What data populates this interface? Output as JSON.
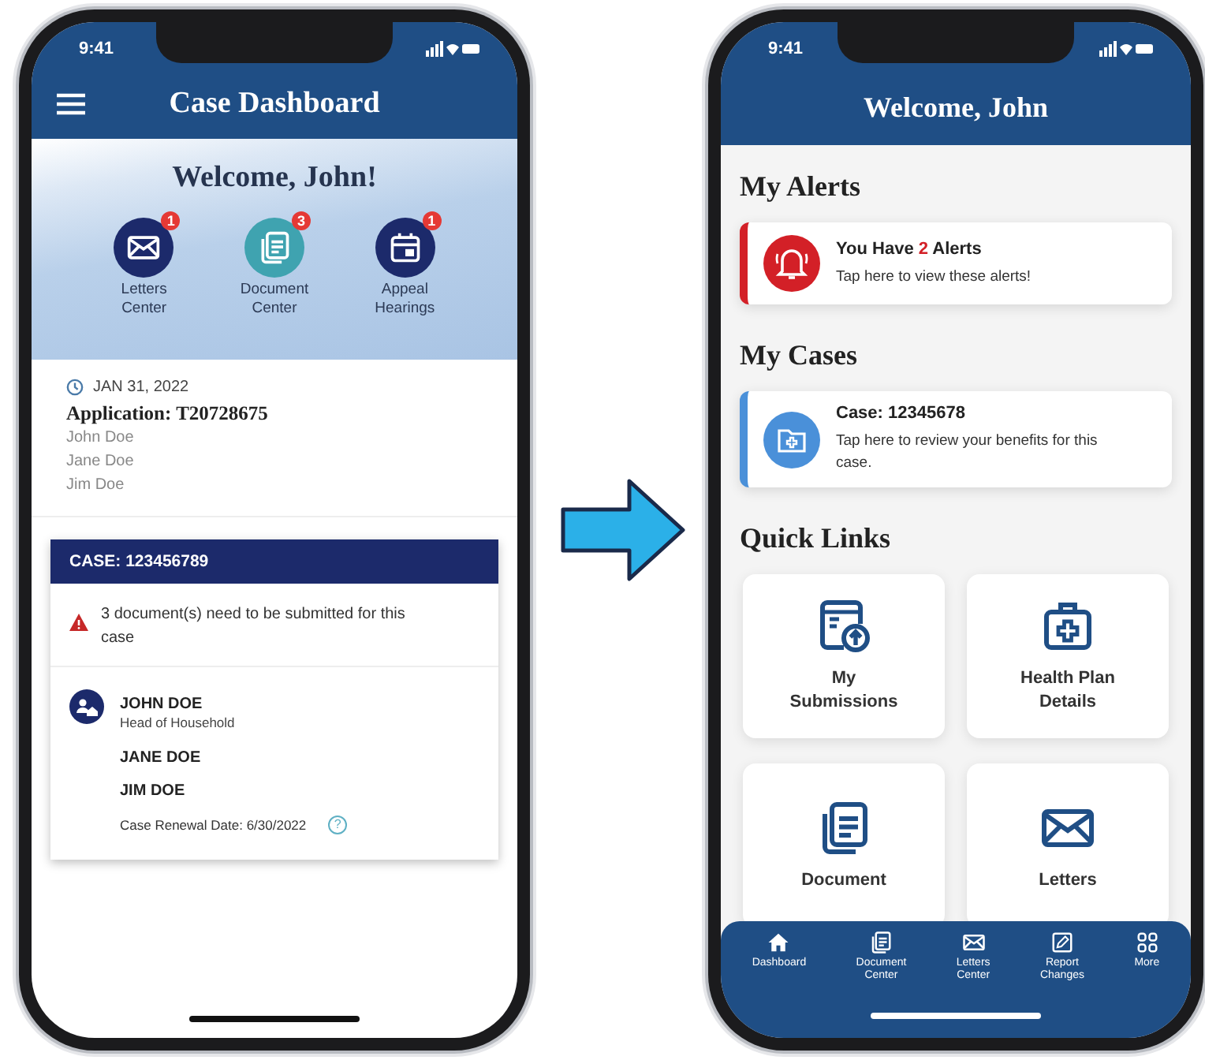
{
  "left_screen": {
    "status_time": "9:41",
    "title": "Case Dashboard",
    "welcome": "Welcome, John!",
    "shortcuts": [
      {
        "kind": "letters",
        "lines": [
          "Letters",
          "Center"
        ],
        "badge": "1"
      },
      {
        "kind": "documents",
        "lines": [
          "Document",
          "Center"
        ],
        "badge": "3"
      },
      {
        "kind": "calendar",
        "lines": [
          "Appeal",
          "Hearings"
        ],
        "badge": "1"
      }
    ],
    "application": {
      "date": "JAN 31, 2022",
      "title": "Application: T20728675",
      "members": [
        "John Doe",
        "Jane Doe",
        "Jim Doe"
      ]
    },
    "case_card": {
      "header": "CASE: 123456789",
      "warning": "3 document(s) need to be submitted for this case",
      "members": [
        {
          "name": "JOHN DOE",
          "role": "Head of Household"
        },
        {
          "name": "JANE DOE"
        },
        {
          "name": "JIM DOE"
        }
      ],
      "renewal": "Case Renewal Date: 6/30/2022",
      "help": "?"
    }
  },
  "right_screen": {
    "status_time": "9:41",
    "title": "Welcome, John",
    "alerts_heading": "My Alerts",
    "alert": {
      "title_start": "You Have",
      "count": "2",
      "title_end": "Alerts",
      "subtitle": "Tap here to view these alerts!"
    },
    "cases_heading": "My Cases",
    "case": {
      "title": "Case: 12345678",
      "subtitle": "Tap here to review your benefits for this case."
    },
    "quick_links_heading": "Quick Links",
    "quick_links": [
      {
        "kind": "submissions",
        "lines": [
          "My",
          "Submissions"
        ]
      },
      {
        "kind": "health",
        "lines": [
          "Health Plan",
          "Details"
        ]
      },
      {
        "kind": "documents",
        "lines": [
          "Document"
        ]
      },
      {
        "kind": "letters",
        "lines": [
          "Letters"
        ]
      }
    ],
    "nav": [
      {
        "kind": "home",
        "lines": [
          "Dashboard"
        ]
      },
      {
        "kind": "documents",
        "lines": [
          "Document",
          "Center"
        ]
      },
      {
        "kind": "letters",
        "lines": [
          "Letters",
          "Center"
        ]
      },
      {
        "kind": "report",
        "lines": [
          "Report",
          "Changes"
        ]
      },
      {
        "kind": "more",
        "lines": [
          "More"
        ]
      }
    ]
  }
}
